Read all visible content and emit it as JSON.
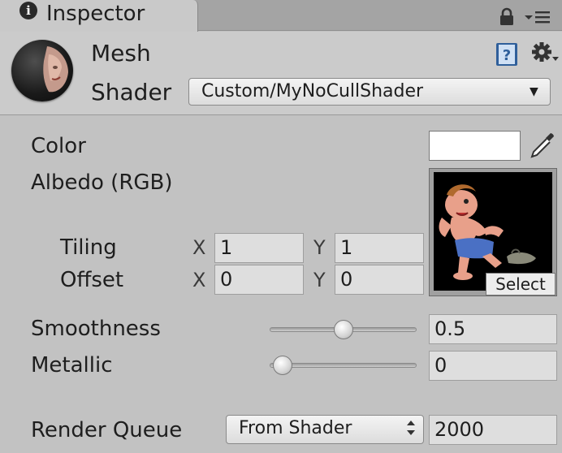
{
  "tab": {
    "title": "Inspector",
    "info_icon": "info-icon",
    "lock_icon": "lock-icon",
    "menu_icon": "tab-menu-icon"
  },
  "header": {
    "title": "Mesh",
    "shader_label": "Shader",
    "shader_value": "Custom/MyNoCullShader",
    "help_icon": "help-book-icon",
    "settings_icon": "gear-icon"
  },
  "properties": {
    "color_label": "Color",
    "color_value": "#ffffff",
    "albedo_label": "Albedo (RGB)",
    "tiling_label": "Tiling",
    "tiling_x": "1",
    "tiling_y": "1",
    "offset_label": "Offset",
    "offset_x": "0",
    "offset_y": "0",
    "axis_x": "X",
    "axis_y": "Y",
    "texture_select": "Select",
    "smoothness_label": "Smoothness",
    "smoothness_value": "0.5",
    "smoothness_fraction": 0.5,
    "metallic_label": "Metallic",
    "metallic_value": "0",
    "metallic_fraction": 0,
    "render_queue_label": "Render Queue",
    "render_queue_mode": "From Shader",
    "render_queue_value": "2000"
  },
  "colors": {
    "window_bg": "#c2c2c2",
    "tab_bar": "#a4a4a4",
    "field_bg": "#dedede"
  }
}
